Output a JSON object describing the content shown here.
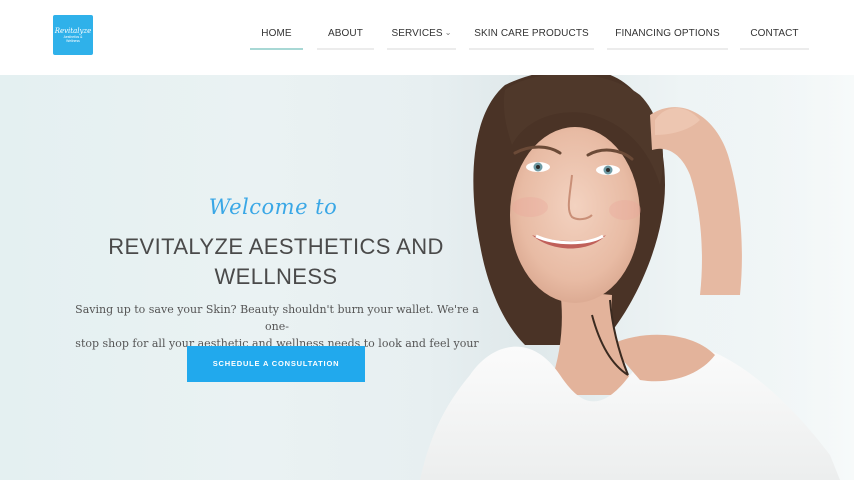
{
  "logo": {
    "line1": "Revitalyze",
    "line2": "Aesthetics &",
    "line3": "Wellness"
  },
  "nav": {
    "items": [
      {
        "label": "HOME"
      },
      {
        "label": "ABOUT"
      },
      {
        "label": "SERVICES"
      },
      {
        "label": "SKIN CARE PRODUCTS"
      },
      {
        "label": "FINANCING OPTIONS"
      },
      {
        "label": "CONTACT"
      }
    ],
    "active": "HOME",
    "services_chevron": "⌄"
  },
  "hero": {
    "welcome": "Welcome to",
    "title_line1": "REVITALYZE AESTHETICS AND",
    "title_line2": "WELLNESS",
    "subtitle_line1": "Saving up to save your Skin? Beauty shouldn't burn your wallet. We're a one-",
    "subtitle_line2": "stop shop for all your aesthetic and wellness needs to look and feel your best.",
    "cta_label": "SCHEDULE A CONSULTATION"
  },
  "colors": {
    "accent": "#21a9ed",
    "script": "#39a7e6",
    "active_underline": "#a8d8d5",
    "logo_bg": "#2fb1ea"
  }
}
